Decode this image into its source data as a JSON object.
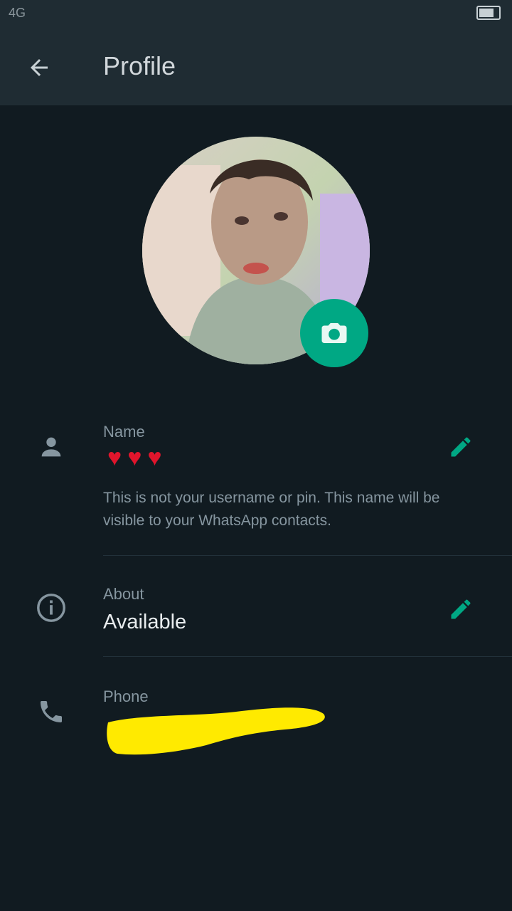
{
  "status_bar": {
    "left": "4G",
    "center": "",
    "right": "",
    "icons": [
      "signal-icon",
      "battery-icon"
    ]
  },
  "appbar": {
    "title": "Profile",
    "back_icon": "arrow-left-icon"
  },
  "avatar": {
    "camera_icon": "camera-icon"
  },
  "name_row": {
    "icon": "person-icon",
    "label": "Name",
    "value": "",
    "hint": "This is not your username or pin. This name will be visible to your WhatsApp contacts.",
    "edit_icon": "pencil-icon"
  },
  "about_row": {
    "icon": "info-icon",
    "label": "About",
    "value": "Available",
    "edit_icon": "pencil-icon"
  },
  "phone_row": {
    "icon": "phone-icon",
    "label": "Phone",
    "value": ""
  },
  "colors": {
    "background": "#111b21",
    "appbar": "#1f2c33",
    "accent": "#00a884",
    "muted_text": "#8696a0",
    "redaction": "#ffea00"
  }
}
